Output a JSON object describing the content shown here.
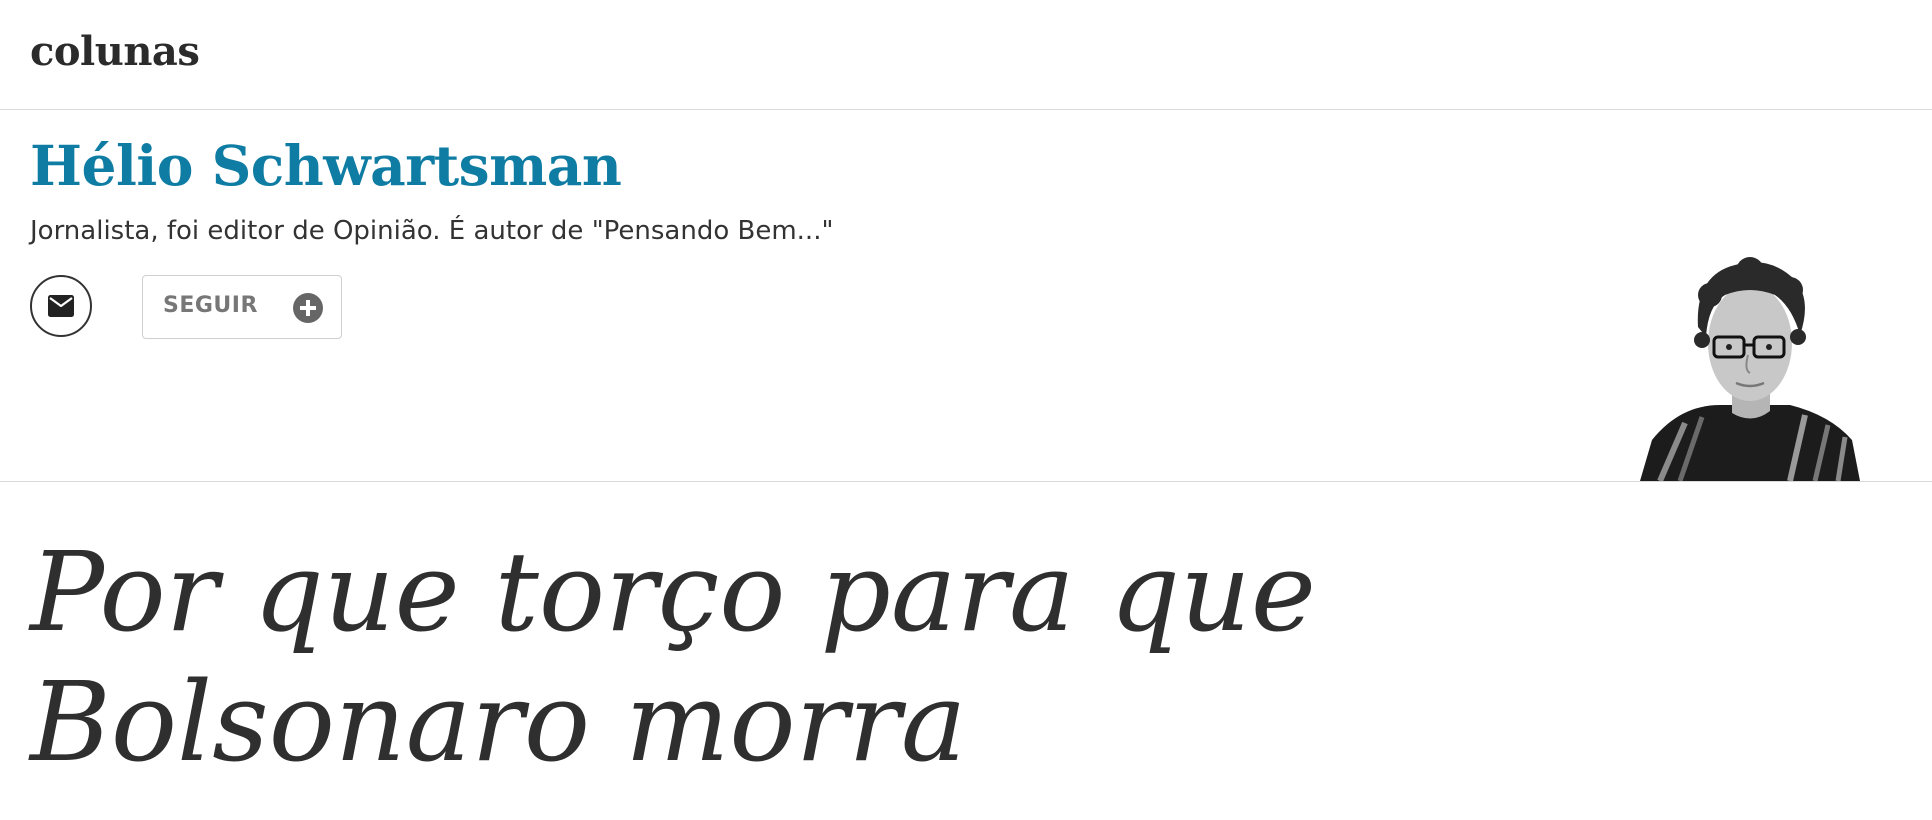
{
  "section": {
    "title": "colunas"
  },
  "author": {
    "name": "Hélio Schwartsman",
    "bio": "Jornalista, foi editor de Opinião. É autor de \"Pensando Bem...\"",
    "photo_icon": "author-portrait",
    "mail_icon": "envelope-icon"
  },
  "actions": {
    "follow_label": "SEGUIR",
    "follow_icon": "plus-circle-icon"
  },
  "article": {
    "headline": "Por que torço para que Bolsonaro morra"
  },
  "colors": {
    "author_name": "#0f7ca3",
    "text": "#2f2f2f",
    "divider": "#d9d9d9",
    "follow_text": "#777777"
  }
}
